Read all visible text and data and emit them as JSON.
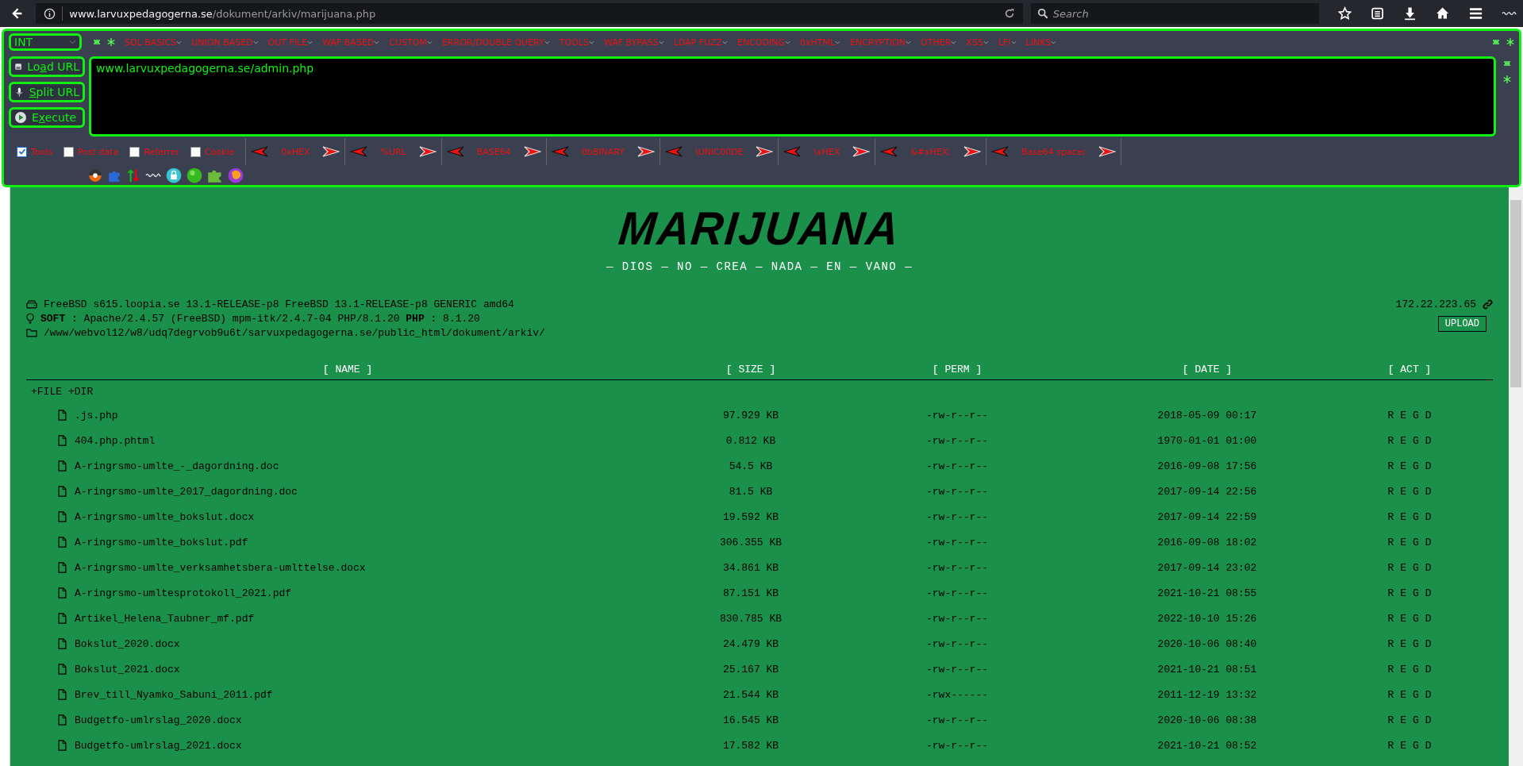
{
  "browser": {
    "url_host": "www.larvuxpedagogerna.se",
    "url_path": "/dokument/arkiv/marijuana.php",
    "search": {
      "placeholder": "Search"
    }
  },
  "hackbar": {
    "select": "INT",
    "menus": [
      "SQL BASICS",
      "UNION BASED",
      "OUT FILE",
      "WAF BASED",
      "CUSTOM",
      "ERROR/DOUBLE QUERY",
      "TOOLS",
      "WAF BYPASS",
      "LDAP FUZZ",
      "ENCODING",
      "0xHTML",
      "ENCRYPTION",
      "OTHER",
      "XSS",
      "LFI",
      "LINKS"
    ],
    "buttons": [
      {
        "kind": "load",
        "lead": "Lo",
        "key": "a",
        "rest": "d URL"
      },
      {
        "kind": "split",
        "key": "S",
        "rest": "plit URL"
      },
      {
        "kind": "execute",
        "lead": "E",
        "key": "x",
        "rest": "ecute"
      }
    ],
    "url_value": "www.larvuxpedagogerna.se/admin.php",
    "checkboxes": [
      {
        "label": "Tools",
        "checked": true
      },
      {
        "label": "Post data",
        "checked": false
      },
      {
        "label": "Referrer",
        "checked": false
      },
      {
        "label": "Cookie",
        "checked": false
      }
    ],
    "encoders": [
      "0xHEX",
      "%URL",
      "BASE64",
      "0bBINARY",
      "\\UNIC00DE",
      "\\xHEX",
      "&#xHEX;",
      "Base64 spacer"
    ]
  },
  "page": {
    "logo": "MARIJUANA",
    "tagline": "— DIOS — NO — CREA — NADA — EN — VANO —",
    "system": "FreeBSD s615.loopia.se 13.1-RELEASE-p8 FreeBSD 13.1-RELEASE-p8 GENERIC amd64",
    "software": "**SOFT** : Apache/2.4.57 (FreeBSD) mpm-itk/2.4.7-04 PHP/8.1.20 **PHP** : 8.1.20",
    "path": "/www/webvol12/w8/udq7degrvob9u6t/sarvuxpedagogerna.se/public_html/dokument/arkiv/",
    "ip": "172.22.223.65",
    "upload": "UPLOAD",
    "columns": [
      "[ NAME ]",
      "[ SIZE ]",
      "[ PERM ]",
      "[ DATE ]",
      "[ ACT ]"
    ],
    "new_links": [
      "+FILE",
      "+DIR"
    ],
    "rows": [
      {
        "name": ".js.php",
        "size": "97.929 KB",
        "perm": "-rw-r--r--",
        "date": "2018-05-09 00:17",
        "actions": [
          "R",
          "E",
          "G",
          "D"
        ]
      },
      {
        "name": "404.php.phtml",
        "size": "0.812 KB",
        "perm": "-rw-r--r--",
        "date": "1970-01-01 01:00",
        "actions": [
          "R",
          "E",
          "G",
          "D"
        ]
      },
      {
        "name": "A-ringrsmo-umlte_-_dagordning.doc",
        "size": "54.5 KB",
        "perm": "-rw-r--r--",
        "date": "2016-09-08 17:56",
        "actions": [
          "R",
          "E",
          "G",
          "D"
        ]
      },
      {
        "name": "A-ringrsmo-umlte_2017_dagordning.doc",
        "size": "81.5 KB",
        "perm": "-rw-r--r--",
        "date": "2017-09-14 22:56",
        "actions": [
          "R",
          "E",
          "G",
          "D"
        ]
      },
      {
        "name": "A-ringrsmo-umlte_bokslut.docx",
        "size": "19.592 KB",
        "perm": "-rw-r--r--",
        "date": "2017-09-14 22:59",
        "actions": [
          "R",
          "E",
          "G",
          "D"
        ]
      },
      {
        "name": "A-ringrsmo-umlte_bokslut.pdf",
        "size": "306.355 KB",
        "perm": "-rw-r--r--",
        "date": "2016-09-08 18:02",
        "actions": [
          "R",
          "E",
          "G",
          "D"
        ]
      },
      {
        "name": "A-ringrsmo-umlte_verksamhetsbera-umlttelse.docx",
        "size": "34.861 KB",
        "perm": "-rw-r--r--",
        "date": "2017-09-14 23:02",
        "actions": [
          "R",
          "E",
          "G",
          "D"
        ]
      },
      {
        "name": "A-ringrsmo-umltesprotokoll_2021.pdf",
        "size": "87.151 KB",
        "perm": "-rw-r--r--",
        "date": "2021-10-21 08:55",
        "actions": [
          "R",
          "E",
          "G",
          "D"
        ]
      },
      {
        "name": "Artikel_Helena_Taubner_mf.pdf",
        "size": "830.785 KB",
        "perm": "-rw-r--r--",
        "date": "2022-10-10 15:26",
        "actions": [
          "R",
          "E",
          "G",
          "D"
        ]
      },
      {
        "name": "Bokslut_2020.docx",
        "size": "24.479 KB",
        "perm": "-rw-r--r--",
        "date": "2020-10-06 08:40",
        "actions": [
          "R",
          "E",
          "G",
          "D"
        ]
      },
      {
        "name": "Bokslut_2021.docx",
        "size": "25.167 KB",
        "perm": "-rw-r--r--",
        "date": "2021-10-21 08:51",
        "actions": [
          "R",
          "E",
          "G",
          "D"
        ]
      },
      {
        "name": "Brev_till_Nyamko_Sabuni_2011.pdf",
        "size": "21.544 KB",
        "perm": "-rwx------",
        "date": "2011-12-19 13:32",
        "actions": [
          "R",
          "E",
          "G",
          "D"
        ]
      },
      {
        "name": "Budgetfo-umlrslag_2020.docx",
        "size": "16.545 KB",
        "perm": "-rw-r--r--",
        "date": "2020-10-06 08:38",
        "actions": [
          "R",
          "E",
          "G",
          "D"
        ]
      },
      {
        "name": "Budgetfo-umlrslag_2021.docx",
        "size": "17.582 KB",
        "perm": "-rw-r--r--",
        "date": "2021-10-21 08:52",
        "actions": [
          "R",
          "E",
          "G",
          "D"
        ]
      }
    ]
  }
}
